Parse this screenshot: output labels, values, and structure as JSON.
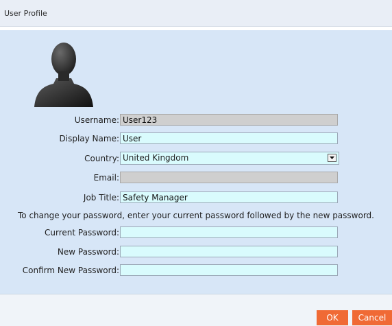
{
  "dialog": {
    "title": "User Profile"
  },
  "form": {
    "username": {
      "label": "Username:",
      "value": "User123"
    },
    "display_name": {
      "label": "Display Name:",
      "value": "User"
    },
    "country": {
      "label": "Country:",
      "value": "United Kingdom"
    },
    "email": {
      "label": "Email:",
      "value": ""
    },
    "job_title": {
      "label": "Job Title:",
      "value": "Safety Manager"
    },
    "password_note": "To change your password, enter your current password followed by the new password.",
    "current_password": {
      "label": "Current Password:",
      "value": ""
    },
    "new_password": {
      "label": "New Password:",
      "value": ""
    },
    "confirm_password": {
      "label": "Confirm New Password:",
      "value": ""
    }
  },
  "buttons": {
    "ok": "OK",
    "cancel": "Cancel"
  },
  "colors": {
    "accent": "#f06a35",
    "content_bg": "#d7e6f7",
    "field_bg": "#d9fbfd",
    "readonly_bg": "#cfcfcf"
  },
  "icons": {
    "avatar": "user-silhouette-icon",
    "dropdown": "chevron-down-icon"
  }
}
